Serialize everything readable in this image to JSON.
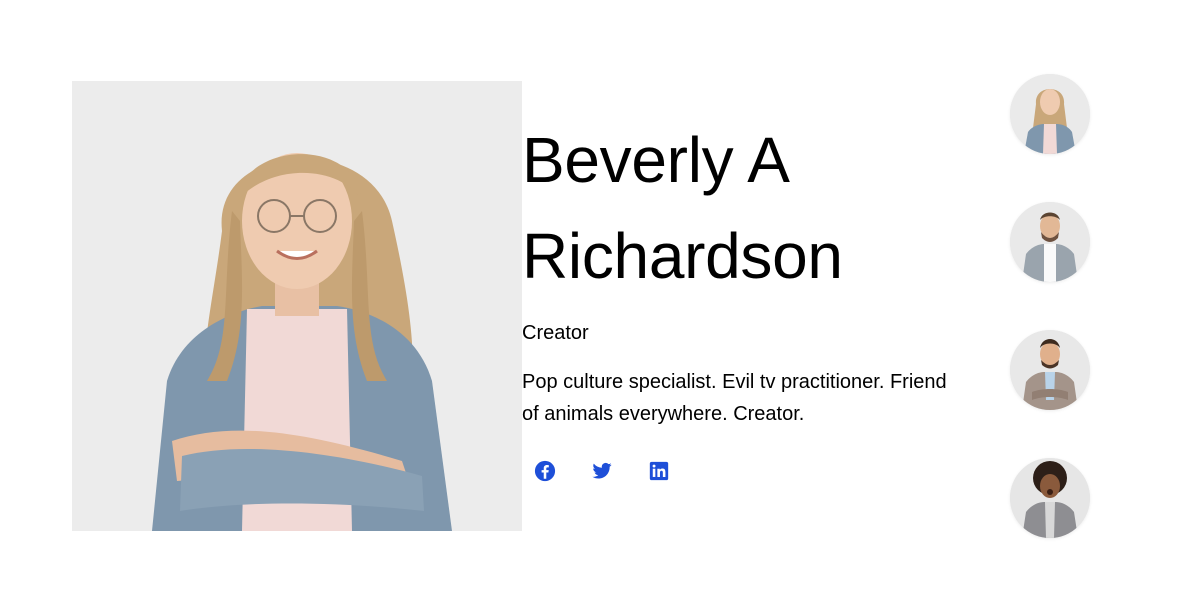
{
  "profile": {
    "name_line1": "Beverly A",
    "name_line2": "Richardson",
    "role": "Creator",
    "bio": "Pop culture specialist. Evil tv practitioner. Friend of animals everywhere. Creator."
  },
  "socials": [
    {
      "icon": "facebook-icon"
    },
    {
      "icon": "twitter-icon"
    },
    {
      "icon": "linkedin-icon"
    }
  ],
  "colors": {
    "accent": "#1e4fd8",
    "portrait_bg": "#ececec"
  }
}
